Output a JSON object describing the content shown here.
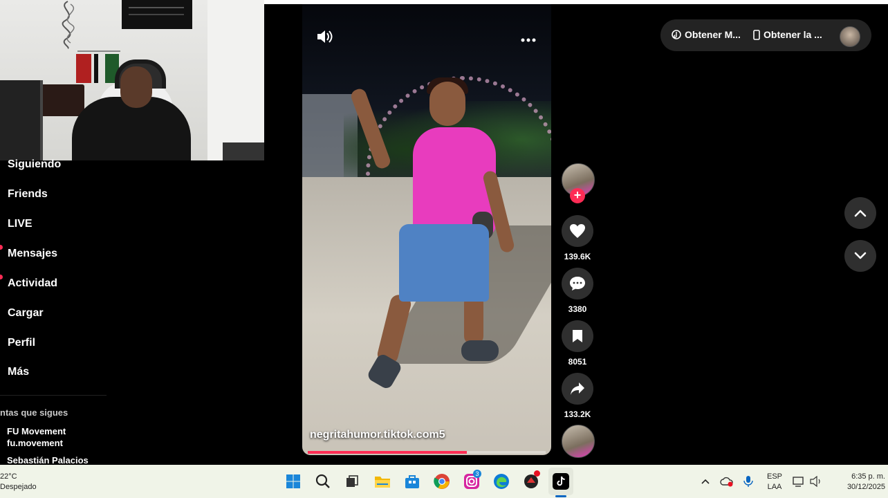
{
  "sidebar": {
    "items": [
      {
        "label": "Siguiendo",
        "dot": false
      },
      {
        "label": "Friends",
        "dot": false
      },
      {
        "label": "LIVE",
        "dot": false
      },
      {
        "label": "Mensajes",
        "dot": true
      },
      {
        "label": "Actividad",
        "dot": true
      },
      {
        "label": "Cargar",
        "dot": false
      },
      {
        "label": "Perfil",
        "dot": false
      },
      {
        "label": "Más",
        "dot": false
      }
    ],
    "following_heading": "ntas que sigues",
    "accounts": [
      {
        "name": "FU Movement",
        "handle": "fu.movement"
      },
      {
        "name": "Sebastián Palacios"
      }
    ]
  },
  "video": {
    "watermark": "negritahumor.tiktok.com5",
    "progress": 0.67,
    "sound_icon": "volume-icon",
    "more_icon": "more-icon"
  },
  "actions": {
    "likes": "139.6K",
    "comments": "3380",
    "saves": "8051",
    "shares": "133.2K"
  },
  "top_pill": {
    "get_app_label": "Obtener M...",
    "get_device_label": "Obtener la ..."
  },
  "taskbar": {
    "temperature": "22°C",
    "weather": "Despejado",
    "lang_top": "ESP",
    "lang_bottom": "LAA",
    "time": "6:35 p. m.",
    "date": "30/12/2025",
    "instagram_badge": "3",
    "accent": "#0a66c2"
  },
  "colors": {
    "brand": "#fe2c55",
    "shirt": "#e83cbe"
  }
}
